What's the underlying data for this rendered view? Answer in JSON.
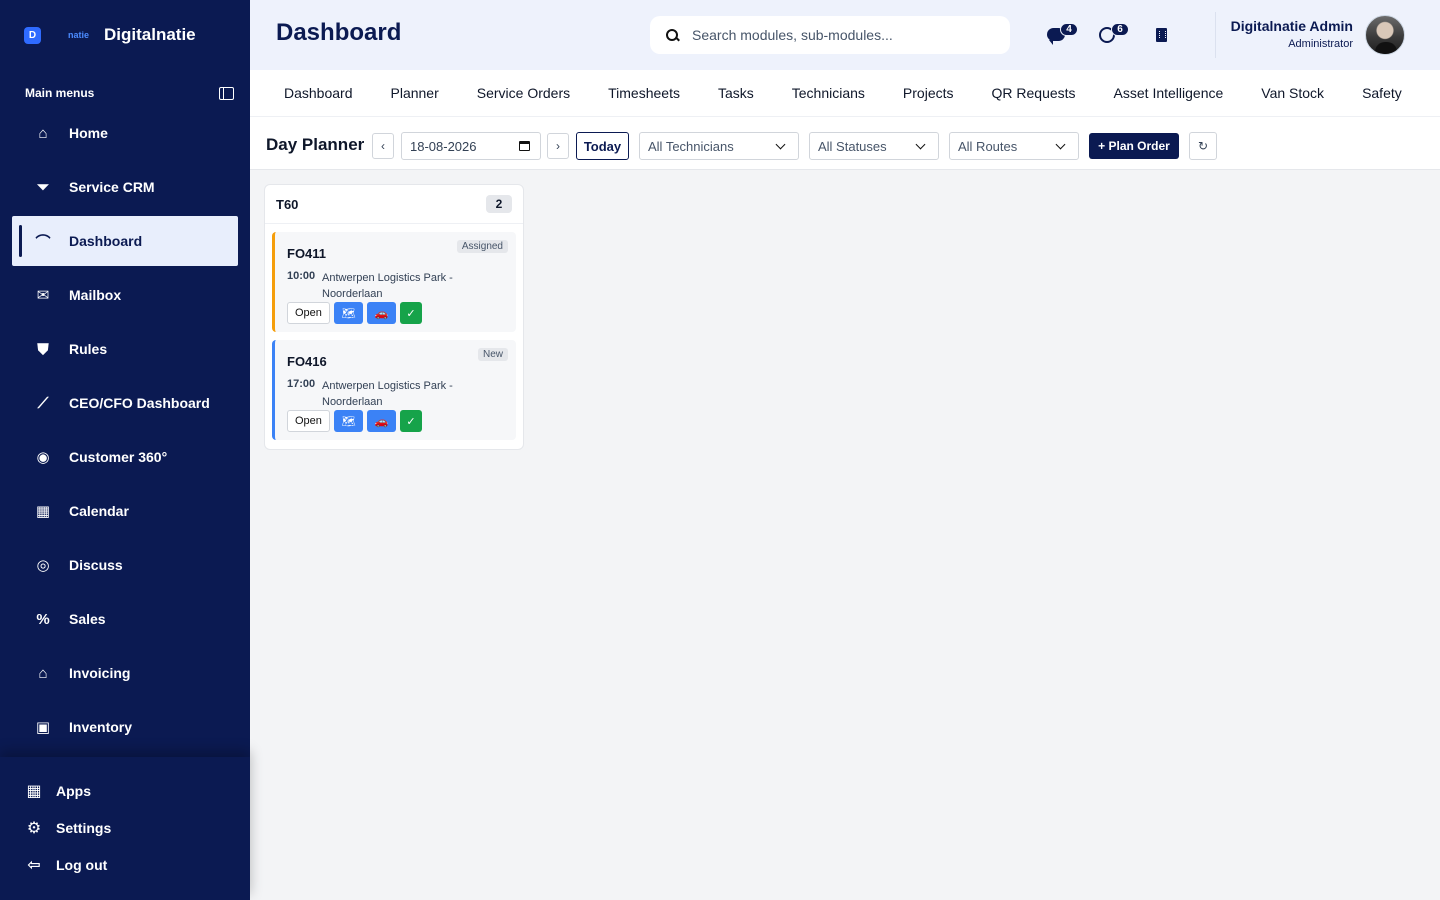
{
  "brand": {
    "badge": "D",
    "small": "natie",
    "name": "Digitalnatie"
  },
  "sidebar": {
    "heading": "Main menus",
    "items": [
      {
        "label": "Home",
        "icon": "⌂"
      },
      {
        "label": "Service CRM",
        "icon": "⏷"
      },
      {
        "label": "Dashboard",
        "icon": "⌒"
      },
      {
        "label": "Mailbox",
        "icon": "✉"
      },
      {
        "label": "Rules",
        "icon": "⛊"
      },
      {
        "label": "CEO/CFO Dashboard",
        "icon": "⟋"
      },
      {
        "label": "Customer 360°",
        "icon": "◉"
      },
      {
        "label": "Calendar",
        "icon": "▦"
      },
      {
        "label": "Discuss",
        "icon": "◎"
      },
      {
        "label": "Sales",
        "icon": "%"
      },
      {
        "label": "Invoicing",
        "icon": "⌂"
      },
      {
        "label": "Inventory",
        "icon": "▣"
      }
    ],
    "bottom": [
      {
        "label": "Apps",
        "icon": "▦"
      },
      {
        "label": "Settings",
        "icon": "⚙"
      },
      {
        "label": "Log out",
        "icon": "⇦"
      }
    ]
  },
  "header": {
    "title": "Dashboard",
    "search_placeholder": "Search modules, sub-modules...",
    "messages_count": "4",
    "activities_count": "6",
    "user_name": "Digitalnatie Admin",
    "user_role": "Administrator"
  },
  "tabs": [
    "Dashboard",
    "Planner",
    "Service Orders",
    "Timesheets",
    "Tasks",
    "Technicians",
    "Projects",
    "QR Requests",
    "Asset Intelligence",
    "Van Stock",
    "Safety"
  ],
  "toolbar": {
    "title": "Day Planner",
    "prev": "‹",
    "next": "›",
    "date": "18-08-2026",
    "today": "Today",
    "technician_filter": "All Technicians",
    "status_filter": "All Statuses",
    "route_filter": "All Routes",
    "plan_order": "+ Plan Order",
    "refresh": "↻"
  },
  "board": {
    "columns": [
      {
        "title": "T60",
        "count": "2",
        "cards": [
          {
            "id": "FO411",
            "status": "Assigned",
            "time": "10:00",
            "location": "Antwerpen Logistics Park - Noorderlaan",
            "open": "Open",
            "map": "🗺",
            "route": "🚗",
            "check": "✓"
          },
          {
            "id": "FO416",
            "status": "New",
            "time": "17:00",
            "location": "Antwerpen Logistics Park - Noorderlaan",
            "open": "Open",
            "map": "🗺",
            "route": "🚗",
            "check": "✓"
          }
        ]
      }
    ]
  },
  "colors": {
    "navy": "#0b1a52",
    "accent_blue": "#3b82f6",
    "assigned_orange": "#f59e0b",
    "done_green": "#16a34a"
  }
}
